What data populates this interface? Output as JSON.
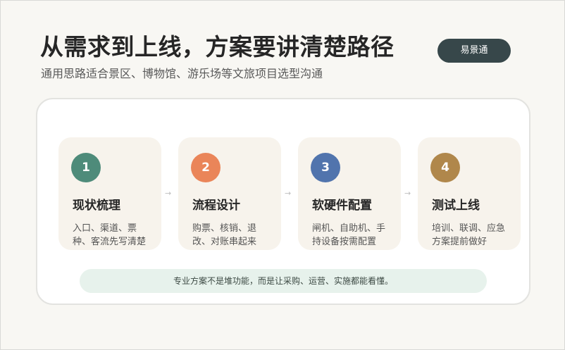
{
  "header": {
    "title": "从需求到上线，方案要讲清楚路径",
    "subtitle": "通用思路适合景区、博物馆、游乐场等文旅项目选型沟通",
    "brand_label": "易景通"
  },
  "steps": [
    {
      "number": "1",
      "title": "现状梳理",
      "description": "入口、渠道、票种、客流先写清楚",
      "color": "#4e8b7a"
    },
    {
      "number": "2",
      "title": "流程设计",
      "description": "购票、核销、退改、对账串起来",
      "color": "#ea8559"
    },
    {
      "number": "3",
      "title": "软硬件配置",
      "description": "闸机、自助机、手持设备按需配置",
      "color": "#5174ad"
    },
    {
      "number": "4",
      "title": "测试上线",
      "description": "培训、联调、应急方案提前做好",
      "color": "#b0874b"
    }
  ],
  "arrows": [
    "→",
    "→",
    "→"
  ],
  "note": "专业方案不是堆功能，而是让采购、运营、实施都能看懂。"
}
